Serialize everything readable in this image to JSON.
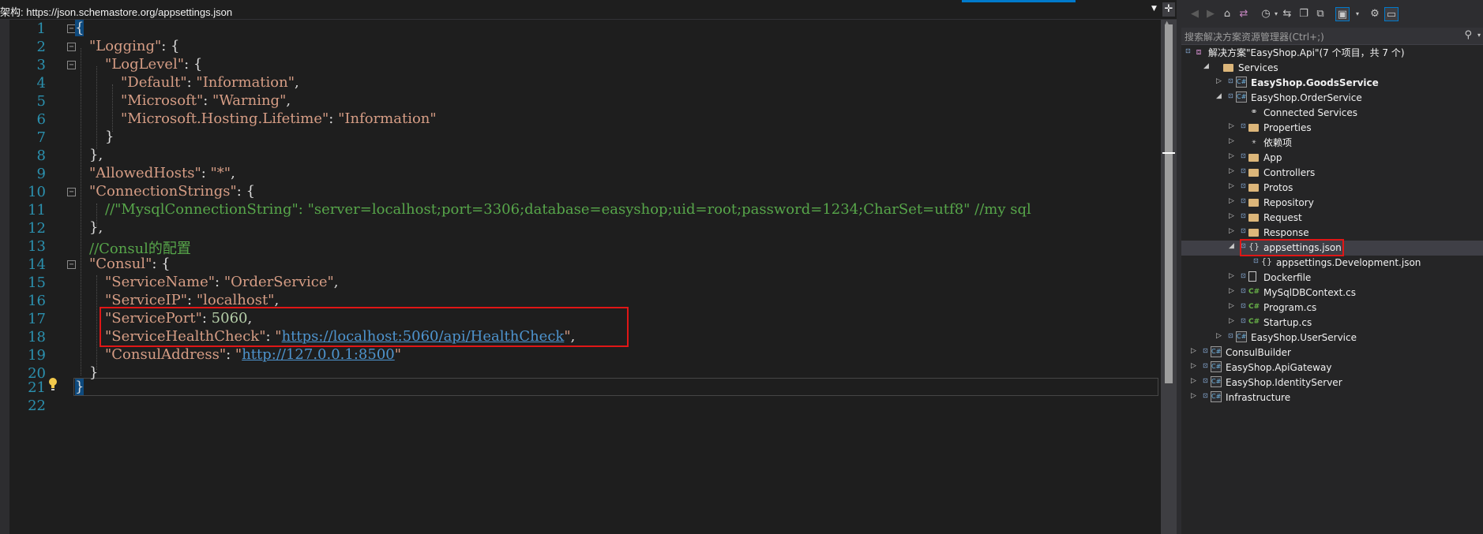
{
  "editor": {
    "schema_text": "架构: https://json.schemastore.org/appsettings.json",
    "lines": [
      {
        "n": "1"
      },
      {
        "n": "2"
      },
      {
        "n": "3"
      },
      {
        "n": "4"
      },
      {
        "n": "5"
      },
      {
        "n": "6"
      },
      {
        "n": "7"
      },
      {
        "n": "8"
      },
      {
        "n": "9"
      },
      {
        "n": "10"
      },
      {
        "n": "11"
      },
      {
        "n": "12"
      },
      {
        "n": "13"
      },
      {
        "n": "14"
      },
      {
        "n": "15"
      },
      {
        "n": "16"
      },
      {
        "n": "17"
      },
      {
        "n": "18"
      },
      {
        "n": "19"
      },
      {
        "n": "20"
      },
      {
        "n": "21"
      },
      {
        "n": "22"
      }
    ],
    "code": {
      "l1_brace": "{",
      "l2_key": "\"Logging\"",
      "l2_rest": ": {",
      "l3_key": "\"LogLevel\"",
      "l3_rest": ": {",
      "l4_key": "\"Default\"",
      "l4_colon": ": ",
      "l4_val": "\"Information\"",
      "l4_end": ",",
      "l5_key": "\"Microsoft\"",
      "l5_colon": ": ",
      "l5_val": "\"Warning\"",
      "l5_end": ",",
      "l6_key": "\"Microsoft.Hosting.Lifetime\"",
      "l6_colon": ": ",
      "l6_val": "\"Information\"",
      "l7": "}",
      "l8": "},",
      "l9_key": "\"AllowedHosts\"",
      "l9_colon": ": ",
      "l9_val": "\"*\"",
      "l9_end": ",",
      "l10_key": "\"ConnectionStrings\"",
      "l10_rest": ": {",
      "l11_comment": "//\"MysqlConnectionString\": \"server=localhost;port=3306;database=easyshop;uid=root;password=1234;CharSet=utf8\" //my sql",
      "l12": "},",
      "l13_comment": "//Consul的配置",
      "l14_key": "\"Consul\"",
      "l14_rest": ": {",
      "l15_key": "\"ServiceName\"",
      "l15_colon": ": ",
      "l15_val": "\"OrderService\"",
      "l15_end": ",",
      "l16_key": "\"ServiceIP\"",
      "l16_colon": ": ",
      "l16_val": "\"localhost\"",
      "l16_end": ",",
      "l17_key": "\"ServicePort\"",
      "l17_colon": ": ",
      "l17_val": "5060",
      "l17_end": ",",
      "l18_key": "\"ServiceHealthCheck\"",
      "l18_colon": ": ",
      "l18_q1": "\"",
      "l18_link": "https://localhost:5060/api/HealthCheck",
      "l18_q2": "\"",
      "l18_end": ",",
      "l19_key": "\"ConsulAddress\"",
      "l19_colon": ": ",
      "l19_q1": "\"",
      "l19_link": "http://127.0.0.1:8500",
      "l19_q2": "\"",
      "l20": "}",
      "l21": "}"
    },
    "fold_glyph": "−"
  },
  "solution_explorer": {
    "search_placeholder": "搜索解决方案资源管理器(Ctrl+;)",
    "search_glyph": "⚲",
    "toolbar_glyphs": {
      "back": "◀",
      "forward": "▶",
      "home": "⌂",
      "switch_views": "⇄",
      "history": "◷",
      "sync": "⇆",
      "collapse": "❐",
      "show_all": "⧉",
      "properties": "▣",
      "settings": "⚙",
      "preview": "▭",
      "dropdown": "▾"
    },
    "tree": [
      {
        "label": "解决方案\"EasyShop.Api\"(7 个项目，共 7 个)",
        "icon": "solution-icon",
        "expander": "",
        "lock": "⊡",
        "glyph": "⧈"
      },
      {
        "label": "Services",
        "icon": "folder-icon",
        "expander": "◢",
        "lock": "",
        "glyph": ""
      },
      {
        "label": "EasyShop.GoodsService",
        "icon": "project-icon",
        "expander": "▷",
        "lock": "⊡",
        "glyph": "C#"
      },
      {
        "label": "EasyShop.OrderService",
        "icon": "project-icon",
        "expander": "◢",
        "lock": "⊡",
        "glyph": "C#"
      },
      {
        "label": "Connected Services",
        "icon": "connected-services-icon",
        "expander": "",
        "lock": "",
        "glyph": "⚭"
      },
      {
        "label": "Properties",
        "icon": "properties-folder-icon",
        "expander": "▷",
        "lock": "⊡",
        "glyph": ""
      },
      {
        "label": "依赖项",
        "icon": "dependencies-icon",
        "expander": "▷",
        "lock": "",
        "glyph": "⚹"
      },
      {
        "label": "App",
        "icon": "folder-icon",
        "expander": "▷",
        "lock": "⊡",
        "glyph": ""
      },
      {
        "label": "Controllers",
        "icon": "folder-icon",
        "expander": "▷",
        "lock": "⊡",
        "glyph": ""
      },
      {
        "label": "Protos",
        "icon": "folder-icon",
        "expander": "▷",
        "lock": "⊡",
        "glyph": ""
      },
      {
        "label": "Repository",
        "icon": "folder-icon",
        "expander": "▷",
        "lock": "⊡",
        "glyph": ""
      },
      {
        "label": "Request",
        "icon": "folder-icon",
        "expander": "▷",
        "lock": "⊡",
        "glyph": ""
      },
      {
        "label": "Response",
        "icon": "folder-icon",
        "expander": "▷",
        "lock": "⊡",
        "glyph": ""
      },
      {
        "label": "appsettings.json",
        "icon": "json-file-icon",
        "expander": "◢",
        "lock": "⊡",
        "glyph": "{}"
      },
      {
        "label": "appsettings.Development.json",
        "icon": "json-file-icon",
        "expander": "",
        "lock": "⊡",
        "glyph": "{}"
      },
      {
        "label": "Dockerfile",
        "icon": "file-icon",
        "expander": "▷",
        "lock": "⊡",
        "glyph": ""
      },
      {
        "label": "MySqlDBContext.cs",
        "icon": "csharp-file-icon",
        "expander": "▷",
        "lock": "⊡",
        "glyph": "C#"
      },
      {
        "label": "Program.cs",
        "icon": "csharp-file-icon",
        "expander": "▷",
        "lock": "⊡",
        "glyph": "C#"
      },
      {
        "label": "Startup.cs",
        "icon": "csharp-file-icon",
        "expander": "▷",
        "lock": "⊡",
        "glyph": "C#"
      },
      {
        "label": "EasyShop.UserService",
        "icon": "project-icon",
        "expander": "▷",
        "lock": "⊡",
        "glyph": "C#"
      },
      {
        "label": "ConsulBuilder",
        "icon": "project-icon",
        "expander": "▷",
        "lock": "⊡",
        "glyph": "C#"
      },
      {
        "label": "EasyShop.ApiGateway",
        "icon": "project-icon",
        "expander": "▷",
        "lock": "⊡",
        "glyph": "C#"
      },
      {
        "label": "EasyShop.IdentityServer",
        "icon": "project-icon",
        "expander": "▷",
        "lock": "⊡",
        "glyph": "C#"
      },
      {
        "label": "Infrastructure",
        "icon": "project-icon",
        "expander": "▷",
        "lock": "⊡",
        "glyph": "C#"
      }
    ]
  }
}
